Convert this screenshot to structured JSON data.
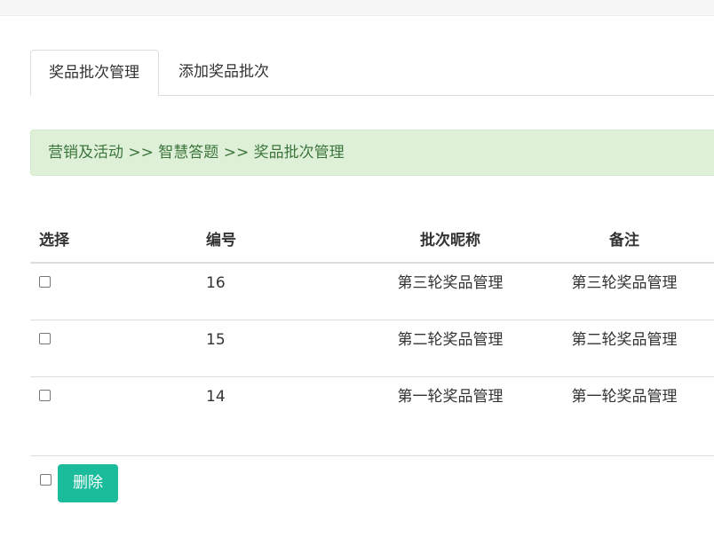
{
  "tabs": [
    {
      "label": "奖品批次管理",
      "active": true
    },
    {
      "label": "添加奖品批次",
      "active": false
    }
  ],
  "breadcrumb": "营销及活动 >> 智慧答题 >> 奖品批次管理",
  "table": {
    "headers": {
      "select": "选择",
      "id": "编号",
      "name": "批次昵称",
      "remark": "备注"
    },
    "rows": [
      {
        "id": "16",
        "name": "第三轮奖品管理",
        "remark": "第三轮奖品管理"
      },
      {
        "id": "15",
        "name": "第二轮奖品管理",
        "remark": "第二轮奖品管理"
      },
      {
        "id": "14",
        "name": "第一轮奖品管理",
        "remark": "第一轮奖品管理"
      }
    ]
  },
  "actions": {
    "delete_label": "删除"
  },
  "colors": {
    "primary_button": "#1abc9c",
    "breadcrumb_bg": "#dff0d8",
    "breadcrumb_text": "#3c763d"
  }
}
